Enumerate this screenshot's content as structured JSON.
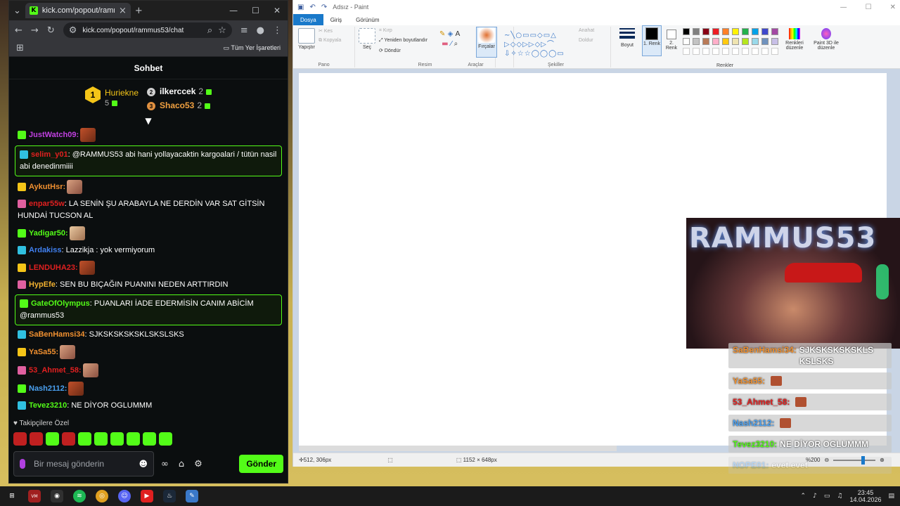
{
  "browser": {
    "tab_title": "kick.com/popout/rammus53/ch",
    "url": "kick.com/popout/rammus53/chat",
    "bookmarks_label": "Tüm Yer İşaretleri"
  },
  "chat": {
    "title": "Sohbet",
    "leaderboard": {
      "first": {
        "rank": "1",
        "name": "Huriekne",
        "score": "5"
      },
      "second": {
        "rank": "2",
        "name": "ilkercсek",
        "score": "2"
      },
      "third": {
        "rank": "3",
        "name": "Shaco53",
        "score": "2"
      }
    },
    "messages": [
      {
        "user": "JustWatch09:",
        "text": "",
        "color": "#c040e0",
        "highlight": false,
        "emote": true
      },
      {
        "user": "selim_y01",
        "text": ": @RAMMUS53 abi hani yollayacaktin kargoalari / tütün nasil abi denedinmiiii",
        "color": "#e02020",
        "highlight": true,
        "emote": false
      },
      {
        "user": "AykutHsr:",
        "text": "",
        "color": "#f09030",
        "highlight": false,
        "emote": true
      },
      {
        "user": "enpar55w",
        "text": ": LA SENİN ŞU ARABAYLA NE DERDİN VAR SAT GİTSİN HUNDAİ TUCSON AL",
        "color": "#e02020",
        "highlight": false,
        "emote": false
      },
      {
        "user": "Yadigar50:",
        "text": "",
        "color": "#53fc18",
        "highlight": false,
        "emote": true
      },
      {
        "user": "Ardakiss",
        "text": ": Lazzikja : yok vermiyorum",
        "color": "#4080f0",
        "highlight": false,
        "emote": false
      },
      {
        "user": "LENDUHA23:",
        "text": "",
        "color": "#e02020",
        "highlight": false,
        "emote": true
      },
      {
        "user": "HypEfe",
        "text": ": SEN BU BIÇAĞIN PUANINI NEDEN ARTTIRDIN",
        "color": "#f0b030",
        "highlight": false,
        "emote": false
      },
      {
        "user": "GateOfOlympus",
        "text": ": PUANLARI İADE EDERMİSİN CANIM ABİCİM @rammus53",
        "color": "#53fc18",
        "highlight": true,
        "emote": false
      },
      {
        "user": "SaBenHamsi34",
        "text": ": SJKSKSKSKSKLSKSLSKS",
        "color": "#f09030",
        "highlight": false,
        "emote": false
      },
      {
        "user": "YaSa55:",
        "text": "",
        "color": "#f09030",
        "highlight": false,
        "emote": true
      },
      {
        "user": "53_Ahmet_58:",
        "text": "",
        "color": "#e02020",
        "highlight": false,
        "emote": true
      },
      {
        "user": "Nash2112:",
        "text": "",
        "color": "#4aa0f0",
        "highlight": false,
        "emote": true
      },
      {
        "user": "Tevez3210",
        "text": ": NE DİYOR OGLUMMM",
        "color": "#53fc18",
        "highlight": false,
        "emote": false
      }
    ],
    "followers_only": "Takipçilere Özel",
    "input_placeholder": "Bir mesaj gönderin",
    "send_label": "Gönder"
  },
  "paint": {
    "title": "Adsız - Paint",
    "tabs": [
      "Dosya",
      "Giriş",
      "Görünüm"
    ],
    "groups": {
      "pano": "Pano",
      "resim": "Resim",
      "araclar": "Araçlar",
      "sekiller": "Şekiller",
      "renkler": "Renkler"
    },
    "buttons": {
      "paste": "Yapıştır",
      "cut": "Kes",
      "copy": "Kopyala",
      "select": "Seç",
      "crop": "Kırp",
      "resize": "Yeniden boyutlandır",
      "rotate": "Döndür",
      "brushes": "Fırçalar",
      "outline": "Anahat",
      "fill": "Doldur",
      "size": "Boyut",
      "color1": "1. Renk",
      "color2": "2. Renk",
      "edit_colors": "Renkleri düzenle",
      "paint3d": "Paint 3D ile düzenle"
    },
    "palette": [
      "#000000",
      "#7f7f7f",
      "#880015",
      "#ed1c24",
      "#ff7f27",
      "#fff200",
      "#22b14c",
      "#00a2e8",
      "#3f48cc",
      "#a349a4",
      "#ffffff",
      "#c3c3c3",
      "#b97a57",
      "#ffaec9",
      "#ffc90e",
      "#efe4b0",
      "#b5e61d",
      "#99d9ea",
      "#7092be",
      "#c8bfe7"
    ],
    "status": {
      "cursor": "512, 306px",
      "canvas_size": "1152 × 648px",
      "zoom": "%200"
    }
  },
  "overlay": {
    "brand_text": "RAMMUS53",
    "messages": [
      {
        "user": "SaBenHamsi34:",
        "text": "SJKSKSKSKSKLS KSLSKS",
        "color": "#f09030"
      },
      {
        "user": "YaSa55:",
        "text": "",
        "color": "#f09030"
      },
      {
        "user": "53_Ahmet_58:",
        "text": "",
        "color": "#e02020"
      },
      {
        "user": "Nash2112:",
        "text": "",
        "color": "#4aa0f0"
      },
      {
        "user": "Tevez3210:",
        "text": "NE DİYOR OGLUMMM",
        "color": "#53fc18"
      },
      {
        "user": "NOPE01:",
        "text": "evet evet",
        "color": "#4aa0f0"
      }
    ]
  },
  "taskbar": {
    "time": "23:45",
    "date": "14.04.2026"
  }
}
